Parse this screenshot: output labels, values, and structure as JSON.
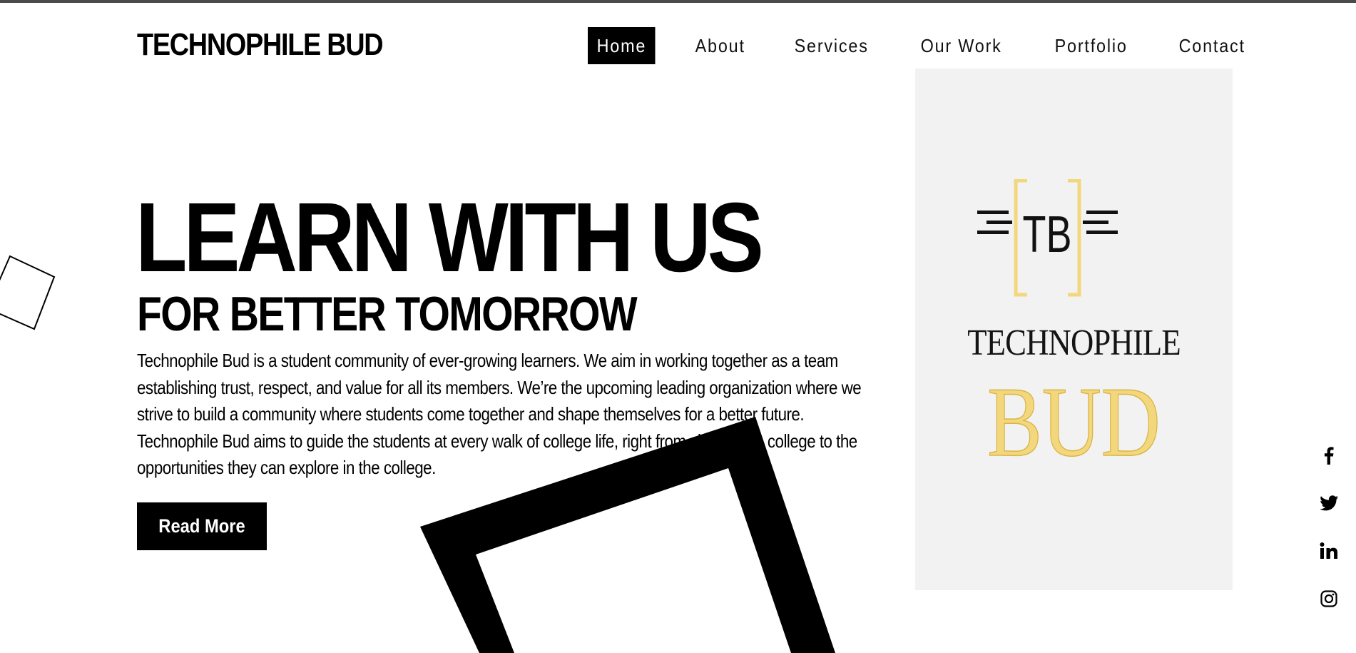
{
  "header": {
    "brand": "TECHNOPHILE BUD",
    "nav": [
      {
        "label": "Home",
        "active": true
      },
      {
        "label": "About",
        "active": false
      },
      {
        "label": "Services",
        "active": false
      },
      {
        "label": "Our Work",
        "active": false
      },
      {
        "label": "Portfolio",
        "active": false
      },
      {
        "label": "Contact",
        "active": false
      }
    ]
  },
  "hero": {
    "headline": "LEARN WITH US",
    "subheadline": "FOR BETTER TOMORROW",
    "description": "Technophile Bud is a student community of ever-growing learners. We aim in working together as a team establishing trust, respect, and value for all its members. We’re the upcoming leading organization where we strive to build a community where students come together and shape themselves for a better future. Technophile Bud aims to guide the students at every walk of college life, right from choosing a college to the opportunities they can explore in the college.",
    "cta_label": "Read More"
  },
  "logo_image": {
    "mark_text": "TB",
    "word1": "TECHNOPHILE",
    "word2": "BUD"
  },
  "social": [
    {
      "icon": "facebook-icon"
    },
    {
      "icon": "twitter-icon"
    },
    {
      "icon": "linkedin-icon"
    },
    {
      "icon": "instagram-icon"
    }
  ],
  "colors": {
    "primary": "#000000",
    "background": "#ffffff",
    "logo_gold": "#f3d77d",
    "logo_panel": "#f2f2f2"
  }
}
